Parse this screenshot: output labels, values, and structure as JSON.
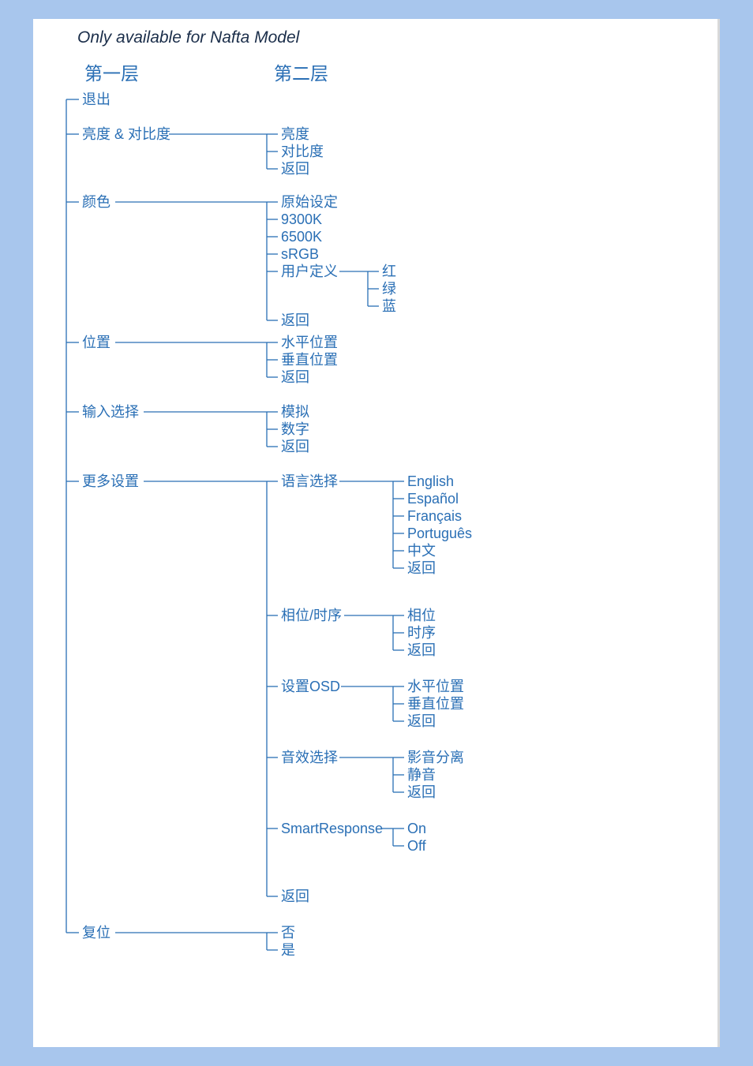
{
  "note": "Only available for Nafta Model",
  "headers": {
    "l1": "第一层",
    "l2": "第二层"
  },
  "l1": {
    "exit": "退出",
    "bright": "亮度 & 对比度",
    "color": "颜色",
    "position": "位置",
    "input": "输入选择",
    "more": "更多设置",
    "reset": "复位"
  },
  "bright": {
    "a": "亮度",
    "b": "对比度",
    "c": "返回"
  },
  "color": {
    "a": "原始设定",
    "b": "9300K",
    "c": "6500K",
    "d": "sRGB",
    "e": "用户定义",
    "f": "返回",
    "user": {
      "r": "红",
      "g": "绿",
      "b": "蓝"
    }
  },
  "pos": {
    "a": "水平位置",
    "b": "垂直位置",
    "c": "返回"
  },
  "inp": {
    "a": "模拟",
    "b": "数字",
    "c": "返回"
  },
  "more": {
    "lang": {
      "label": "语言选择",
      "a": "English",
      "b": "Español",
      "c": "Français",
      "d": "Português",
      "e": "中文",
      "f": "返回"
    },
    "phase": {
      "label": "相位/时序",
      "a": "相位",
      "b": "时序",
      "c": "返回"
    },
    "osd": {
      "label": "设置OSD",
      "a": "水平位置",
      "b": "垂直位置",
      "c": "返回"
    },
    "audio": {
      "label": "音效选择",
      "a": "影音分离",
      "b": "静音",
      "c": "返回"
    },
    "smart": {
      "label": "SmartResponse",
      "a": "On",
      "b": "Off"
    },
    "back": "返回"
  },
  "reset": {
    "a": "否",
    "b": "是"
  }
}
